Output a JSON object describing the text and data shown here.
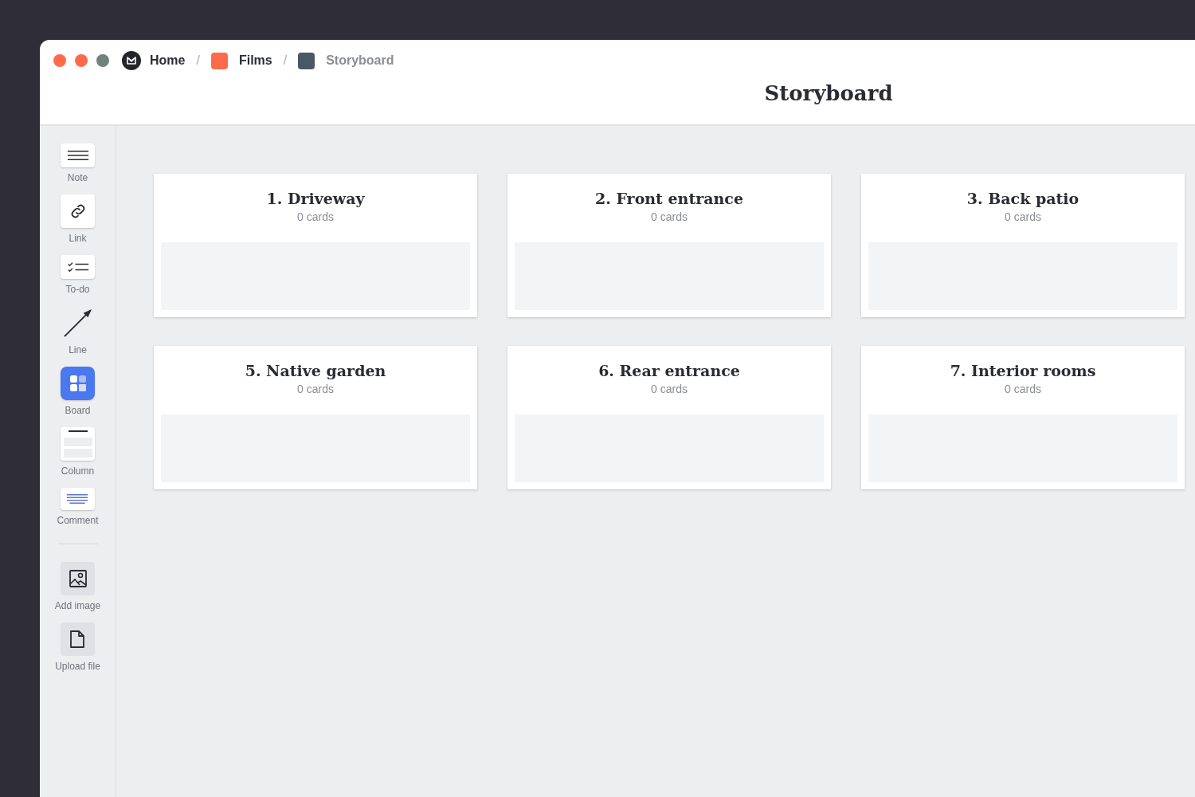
{
  "breadcrumb_separator": "/",
  "breadcrumbs": [
    {
      "kind": "logo",
      "label": "Home",
      "current": false
    },
    {
      "kind": "square",
      "label": "Films",
      "color": "#ff6b4a",
      "current": false
    },
    {
      "kind": "square",
      "label": "Storyboard",
      "color": "#4a5866",
      "current": true
    }
  ],
  "page_title": "Storyboard",
  "toolbar": [
    {
      "kind": "note",
      "label": "Note"
    },
    {
      "kind": "link",
      "label": "Link"
    },
    {
      "kind": "todo",
      "label": "To-do"
    },
    {
      "kind": "line",
      "label": "Line"
    },
    {
      "kind": "board",
      "label": "Board"
    },
    {
      "kind": "column",
      "label": "Column"
    },
    {
      "kind": "comment",
      "label": "Comment"
    },
    {
      "kind": "divider"
    },
    {
      "kind": "image",
      "label": "Add image"
    },
    {
      "kind": "file",
      "label": "Upload file"
    }
  ],
  "boards": [
    {
      "title": "1. Driveway",
      "count": "0 cards"
    },
    {
      "title": "2. Front entrance",
      "count": "0 cards"
    },
    {
      "title": "3. Back patio",
      "count": "0 cards"
    },
    {
      "title": "5. Native garden",
      "count": "0 cards"
    },
    {
      "title": "6. Rear entrance",
      "count": "0 cards"
    },
    {
      "title": "7. Interior rooms",
      "count": "0 cards"
    }
  ]
}
